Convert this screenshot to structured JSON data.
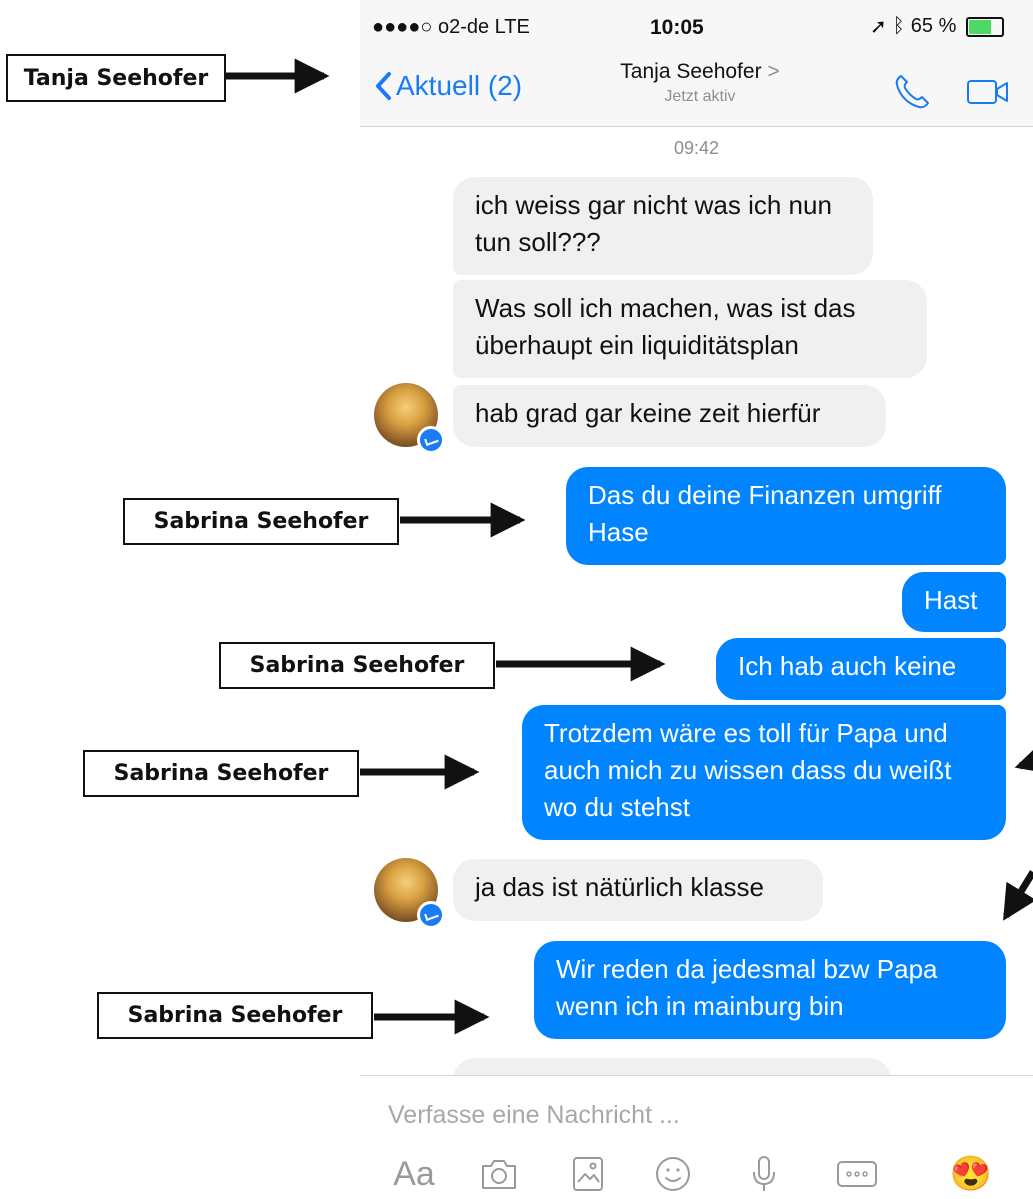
{
  "status_bar": {
    "carrier": "●●●●○ o2-de  LTE",
    "time": "10:05",
    "battery": "65 %",
    "battery_level": 0.65
  },
  "header": {
    "back_label": "Aktuell (2)",
    "contact_name": "Tanja Seehofer",
    "contact_status": "Jetzt aktiv",
    "title_chevron": ">"
  },
  "conversation": {
    "timestamp": "09:42",
    "messages": [
      {
        "from": "contact",
        "text": "ich weiss gar nicht was ich nun tun soll???"
      },
      {
        "from": "contact",
        "text": "Was soll ich machen, was ist das überhaupt ein liquiditätsplan"
      },
      {
        "from": "contact",
        "text": "hab grad gar keine zeit hierfür"
      },
      {
        "from": "me",
        "text": "Das du deine Finanzen umgriff Hase"
      },
      {
        "from": "me",
        "text": "Hast"
      },
      {
        "from": "me",
        "text": "Ich hab auch keine"
      },
      {
        "from": "me",
        "text": "Trotzdem wäre es toll für Papa und auch mich zu wissen dass du weißt wo du stehst"
      },
      {
        "from": "contact",
        "text": "ja das ist nätürlich klasse"
      },
      {
        "from": "me",
        "text": "Wir reden da jedesmal bzw Papa wenn ich in mainburg bin"
      }
    ]
  },
  "composer": {
    "placeholder": "Verfasse eine Nachricht ...",
    "aa_label": "Aa",
    "emoji": "😍"
  },
  "annotations": {
    "header_label": "Tanja Seehofer",
    "message_labels": [
      "Sabrina Seehofer",
      "Sabrina Seehofer",
      "Sabrina Seehofer",
      "Sabrina Seehofer"
    ]
  },
  "colors": {
    "accent": "#0084ff",
    "ios_blue": "#1a7cf5",
    "incoming_bubble": "#f1f0f0",
    "outgoing_text": "#ffffff"
  }
}
